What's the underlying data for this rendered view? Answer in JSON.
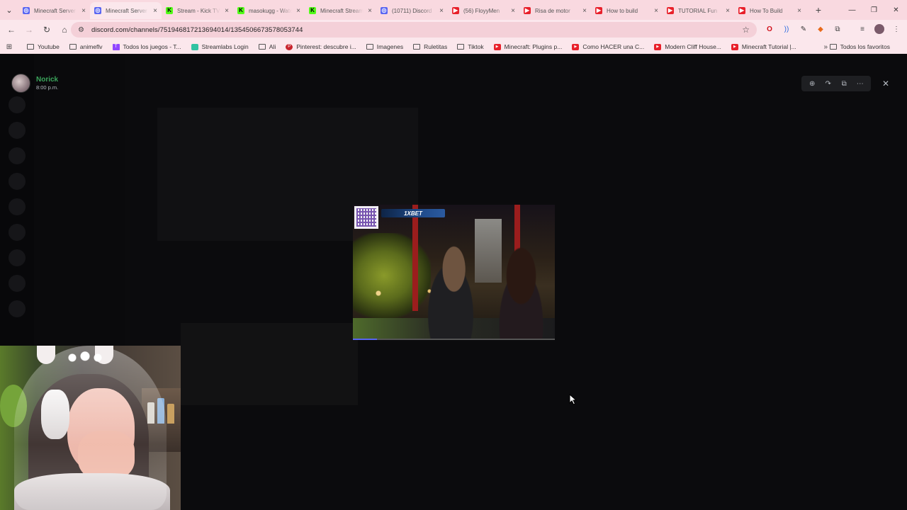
{
  "browser": {
    "tabs": [
      {
        "title": "Minecraft Server",
        "icon": "discord-icon",
        "color": "#5865f2",
        "glyph": "◎"
      },
      {
        "title": "Minecraft Server",
        "icon": "discord-icon",
        "color": "#5865f2",
        "glyph": "◎",
        "active": true
      },
      {
        "title": "Stream - Kick TV",
        "icon": "kick-icon",
        "color": "#53fc18",
        "glyph": "K"
      },
      {
        "title": "masokugg - Watch",
        "icon": "kick-icon",
        "color": "#53fc18",
        "glyph": "K"
      },
      {
        "title": "Minecraft Stream",
        "icon": "kick-icon",
        "color": "#53fc18",
        "glyph": "K"
      },
      {
        "title": "(10711) Discord",
        "icon": "discord-red-icon",
        "color": "#5865f2",
        "glyph": "◎"
      },
      {
        "title": "(56) FloyyMen",
        "icon": "youtube-icon",
        "color": "#e8202a",
        "glyph": "▶"
      },
      {
        "title": "Risa de motor",
        "icon": "youtube-icon",
        "color": "#e8202a",
        "glyph": "▶"
      },
      {
        "title": "How to build",
        "icon": "youtube-icon",
        "color": "#e8202a",
        "glyph": "▶"
      },
      {
        "title": "TUTORIAL Fun",
        "icon": "youtube-icon",
        "color": "#e8202a",
        "glyph": "▶"
      },
      {
        "title": "How To Build",
        "icon": "youtube-icon",
        "color": "#e8202a",
        "glyph": "▶"
      }
    ],
    "url": "discord.com/channels/751946817213694014/1354506673578053744"
  },
  "bookmarks": {
    "items": [
      {
        "label": "Youtube",
        "type": "folder"
      },
      {
        "label": "animeflv",
        "type": "folder"
      },
      {
        "label": "Todos los juegos - T...",
        "type": "tw"
      },
      {
        "label": "Streamlabs Login",
        "type": "sl"
      },
      {
        "label": "Ali",
        "type": "folder"
      },
      {
        "label": "Pinterest: descubre i...",
        "type": "pin"
      },
      {
        "label": "Imagenes",
        "type": "folder"
      },
      {
        "label": "Ruletitas",
        "type": "folder"
      },
      {
        "label": "Tiktok",
        "type": "folder"
      },
      {
        "label": "Minecraft: Plugins p...",
        "type": "yt"
      },
      {
        "label": "Como HACER una C...",
        "type": "yt"
      },
      {
        "label": "Modern Cliff House...",
        "type": "yt"
      },
      {
        "label": "Minecraft Tutorial |...",
        "type": "yt"
      }
    ],
    "all_label": "Todos los favoritos"
  },
  "viewer": {
    "author_name": "Norick",
    "timestamp": "8:00 p.m.",
    "video": {
      "sponsor_text": "1XBET",
      "progress": 0.12
    }
  },
  "colors": {
    "author_name": "#3ba55c",
    "accent": "#5865f2",
    "tabbar": "#f9d9e0"
  }
}
